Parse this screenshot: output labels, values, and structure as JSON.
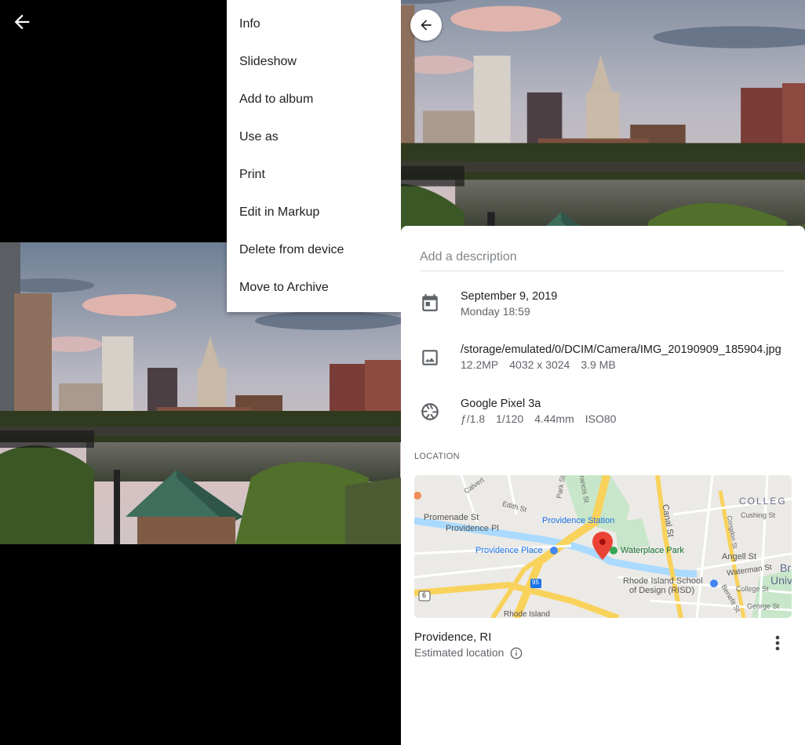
{
  "viewer": {
    "back_icon": "arrow-back-icon",
    "menu": {
      "items": [
        {
          "label": "Info"
        },
        {
          "label": "Slideshow"
        },
        {
          "label": "Add to album"
        },
        {
          "label": "Use as"
        },
        {
          "label": "Print"
        },
        {
          "label": "Edit in Markup"
        },
        {
          "label": "Delete from device"
        },
        {
          "label": "Move to Archive"
        }
      ]
    }
  },
  "info_panel": {
    "back_icon": "arrow-back-icon",
    "description_placeholder": "Add a description",
    "date": {
      "icon": "calendar-icon",
      "title": "September 9, 2019",
      "subtitle": "Monday 18:59"
    },
    "file": {
      "icon": "image-icon",
      "title": "/storage/emulated/0/DCIM/Camera/IMG_20190909_185904.jpg",
      "megapixels": "12.2MP",
      "resolution": "4032 x 3024",
      "size": "3.9 MB"
    },
    "camera": {
      "icon": "aperture-icon",
      "title": "Google Pixel 3a",
      "aperture": "ƒ/1.8",
      "shutter": "1/120",
      "focal_length": "4.44mm",
      "iso": "ISO80"
    },
    "location_section_label": "LOCATION",
    "map": {
      "labels": {
        "college": "COLLEG",
        "cushing": "Cushing St",
        "promenade": "Promenade St",
        "providence_pl": "Providence Pl",
        "providence_station": "Providence Station",
        "providence_place": "Providence Place",
        "waterplace": "Waterplace Park",
        "canal": "Canal St",
        "angell": "Angell St",
        "waterman": "Waterman St",
        "risd1": "Rhode Island School",
        "risd2": "of Design (RISD)",
        "college_st": "College St",
        "george": "George St",
        "benefit": "Benefit St",
        "edith": "Edith St",
        "park": "Park St",
        "francis": "Francis St",
        "calvert": "Calvert",
        "congdon": "Congdon St",
        "univ": "Univ",
        "br": "Br",
        "rhode_island_bottom": "Rhode Island",
        "route_95": "95",
        "route_6": "6"
      },
      "colors": {
        "pin": "#ea4335",
        "water": "#aadaff",
        "park": "#c8e6c9",
        "highway": "#f9d25b"
      }
    },
    "location": {
      "title": "Providence, RI",
      "subtitle": "Estimated location",
      "info_icon": "info-icon",
      "more_icon": "more-vert-icon"
    }
  }
}
